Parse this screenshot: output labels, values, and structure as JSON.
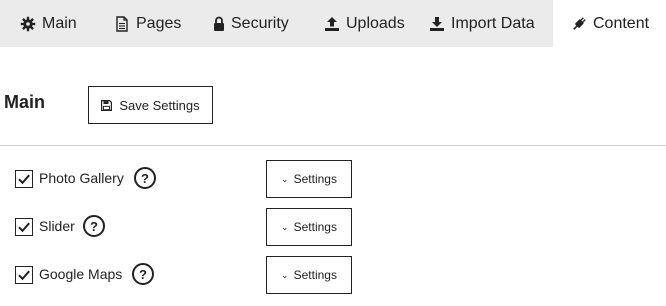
{
  "tabs": [
    {
      "label": "Main",
      "icon": "gear-icon"
    },
    {
      "label": "Pages",
      "icon": "file-icon"
    },
    {
      "label": "Security",
      "icon": "lock-icon"
    },
    {
      "label": "Uploads",
      "icon": "upload-icon"
    },
    {
      "label": "Import Data",
      "icon": "download-icon"
    },
    {
      "label": "Content",
      "icon": "plug-icon",
      "active": true
    }
  ],
  "section": {
    "title": "Main",
    "save_label": "Save Settings",
    "save_icon": "floppy-disk-icon"
  },
  "rows": [
    {
      "label": "Photo Gallery",
      "checked": true,
      "help": "?",
      "settings_label": "Settings",
      "settings_icon": "chevron-down-icon"
    },
    {
      "label": "Slider",
      "checked": true,
      "help": "?",
      "settings_label": "Settings",
      "settings_icon": "chevron-down-icon"
    },
    {
      "label": "Google Maps",
      "checked": true,
      "help": "?",
      "settings_label": "Settings",
      "settings_icon": "chevron-down-icon"
    }
  ]
}
